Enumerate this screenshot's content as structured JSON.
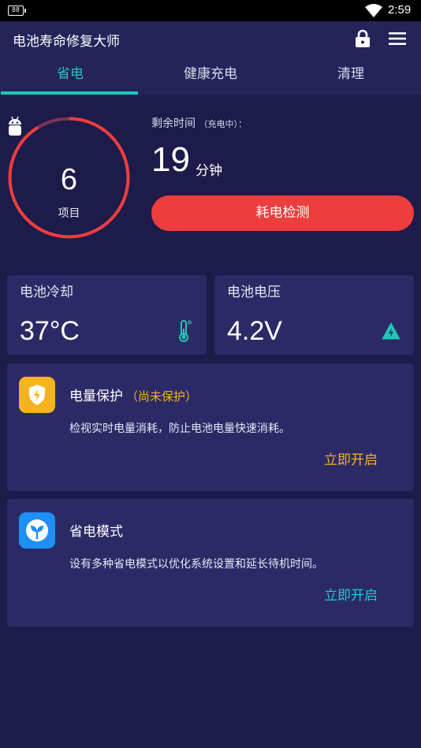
{
  "status_bar": {
    "battery": "88",
    "time": "2:59"
  },
  "app_bar": {
    "title": "电池寿命修复大师"
  },
  "tabs": [
    {
      "label": "省电",
      "active": true
    },
    {
      "label": "健康充电",
      "active": false
    },
    {
      "label": "清理",
      "active": false
    }
  ],
  "summary": {
    "item_count": "6",
    "item_label": "项目",
    "remaining_label": "剩余时间",
    "remaining_state": "（充电中）：",
    "remaining_value": "19",
    "remaining_unit": "分钟",
    "detect_button": "耗电检测"
  },
  "stats": {
    "cooling": {
      "title": "电池冷却",
      "value": "37°C"
    },
    "voltage": {
      "title": "电池电压",
      "value": "4.2V"
    }
  },
  "features": [
    {
      "title": "电量保护",
      "status": "（尚未保护）",
      "description": "检视实时电量消耗，防止电池电量快速消耗。",
      "action": "立即开启",
      "action_color": "#f5b31d",
      "icon": "shield-lightning-icon",
      "icon_color": "#f5b31d"
    },
    {
      "title": "省电模式",
      "status": "",
      "description": "设有多种省电模式以优化系统设置和延长待机时间。",
      "action": "立即开启",
      "action_color": "#1ec8d8",
      "icon": "leaf-sprout-icon",
      "icon_color": "#1e90f5"
    }
  ],
  "colors": {
    "background": "#1c1b4a",
    "card": "#2c2a66",
    "accent": "#1ec8b4",
    "danger": "#ee3d3d",
    "warning": "#f5b31d"
  }
}
